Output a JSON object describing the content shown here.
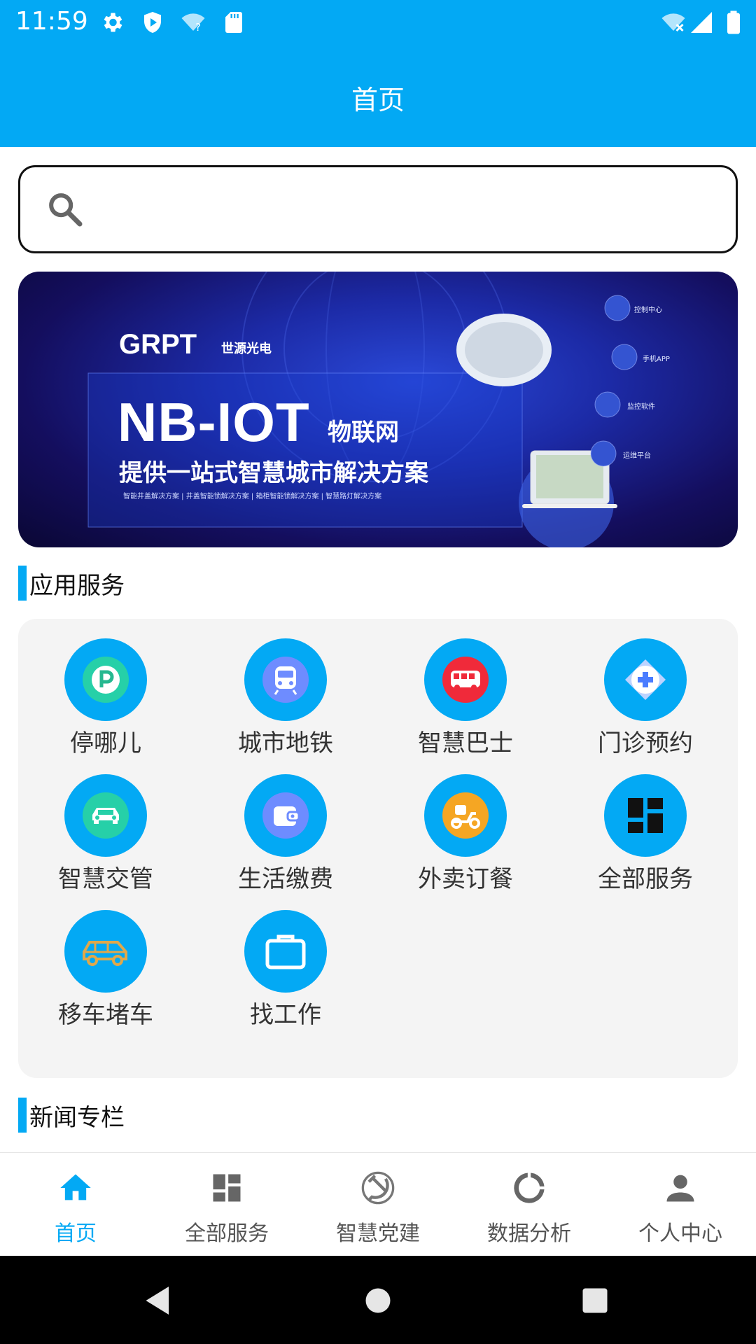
{
  "status_bar": {
    "time": "11:59",
    "icons": [
      "gear-icon",
      "shield-icon",
      "wifi-question-icon",
      "sd-card-icon",
      "wifi-off-icon",
      "signal-icon",
      "battery-icon"
    ]
  },
  "app_bar": {
    "title": "首页"
  },
  "search": {
    "placeholder": "",
    "value": "",
    "icon": "search-icon"
  },
  "banner": {
    "brand": "GRPT",
    "brand_cn": "世源光电",
    "headline": "NB-IOT",
    "headline_cn": "物联网",
    "subtitle": "提供一站式智慧城市解决方案",
    "subline": "智能井盖解决方案 | 井盖智能锁解决方案 | 箱柜智能锁解决方案 | 智慧路灯解决方案",
    "right_labels": [
      "控制中心",
      "手机APP",
      "监控软件",
      "运维平台"
    ]
  },
  "sections": {
    "services_title": "应用服务",
    "news_title": "新闻专栏"
  },
  "services": [
    {
      "label": "停哪儿",
      "icon": "parking-icon"
    },
    {
      "label": "城市地铁",
      "icon": "metro-icon"
    },
    {
      "label": "智慧巴士",
      "icon": "bus-icon"
    },
    {
      "label": "门诊预约",
      "icon": "medical-cross-icon"
    },
    {
      "label": "智慧交管",
      "icon": "car-icon"
    },
    {
      "label": "生活缴费",
      "icon": "wallet-icon"
    },
    {
      "label": "外卖订餐",
      "icon": "scooter-icon"
    },
    {
      "label": "全部服务",
      "icon": "grid-icon"
    },
    {
      "label": "移车堵车",
      "icon": "car-outline-icon"
    },
    {
      "label": "找工作",
      "icon": "briefcase-icon"
    }
  ],
  "bottom_nav": [
    {
      "label": "首页",
      "icon": "home-icon",
      "active": true
    },
    {
      "label": "全部服务",
      "icon": "dashboard-icon",
      "active": false
    },
    {
      "label": "智慧党建",
      "icon": "hammer-sickle-icon",
      "active": false
    },
    {
      "label": "数据分析",
      "icon": "donut-chart-icon",
      "active": false
    },
    {
      "label": "个人中心",
      "icon": "person-icon",
      "active": false
    }
  ],
  "colors": {
    "primary": "#03a9f4",
    "services_bg": "#f4f4f4",
    "text": "#333333"
  }
}
